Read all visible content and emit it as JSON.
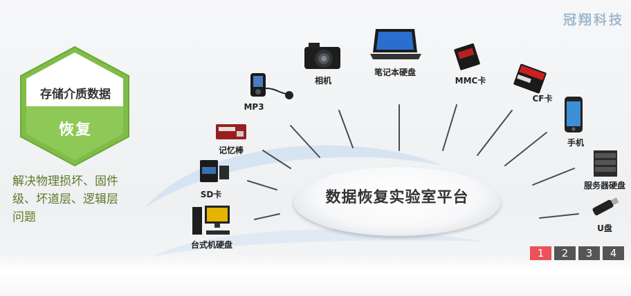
{
  "brand": {
    "text": "冠翔科技",
    "color": "#9fb9cf"
  },
  "badge": {
    "title": "存储介质数据",
    "subtitle": "恢复",
    "color": "#7fbd48"
  },
  "description": {
    "line1": "解决物理损坏、固件",
    "line2": "级、坏道层、逻辑层",
    "line3": "问题",
    "color": "#5d7a27"
  },
  "platform": {
    "label": "数据恢复实验室平台"
  },
  "devices": {
    "desktop": "台式机硬盘",
    "sd": "SD卡",
    "memstick": "记忆棒",
    "mp3": "MP3",
    "camera": "相机",
    "laptop": "笔记本硬盘",
    "mmc": "MMC卡",
    "cf": "CF卡",
    "phone": "手机",
    "server": "服务器硬盘",
    "usb": "U盘"
  },
  "pager": {
    "pages": [
      "1",
      "2",
      "3",
      "4"
    ],
    "active": "1",
    "active_color": "#e8535a"
  }
}
